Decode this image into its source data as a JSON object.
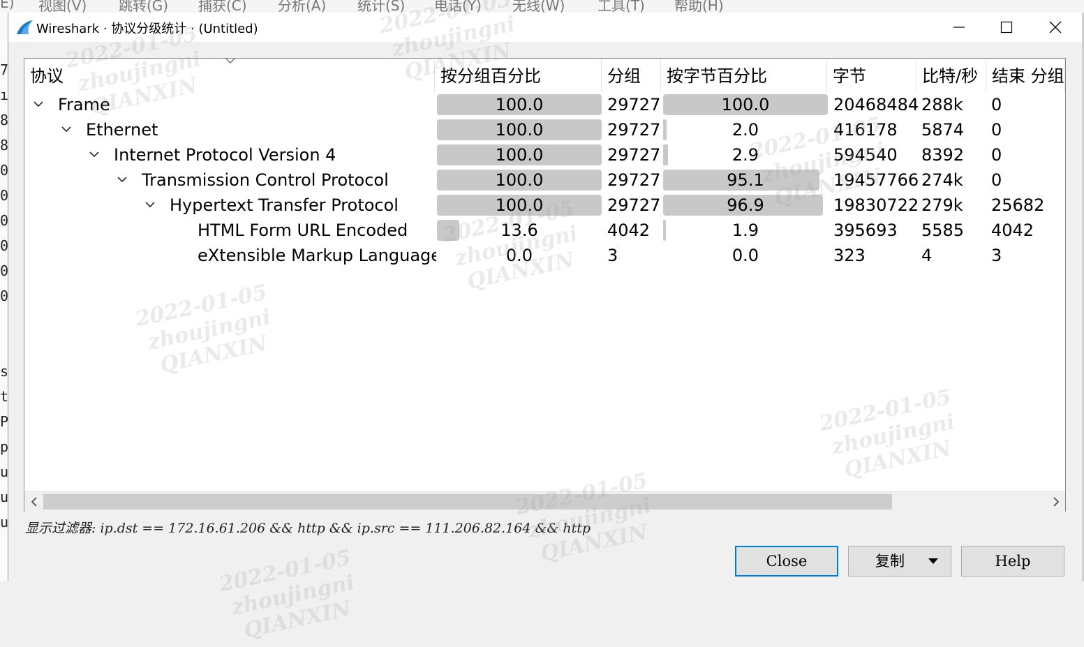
{
  "background_window": {
    "menu": [
      "E)",
      "视图(V)",
      "跳转(G)",
      "捕获(C)",
      "分析(A)",
      "统计(S)",
      "电话(Y)",
      "无线(W)",
      "工具(T)",
      "帮助(H)"
    ],
    "left_fragments": [
      "7",
      "ı",
      "8",
      "8",
      "0",
      "0",
      "0",
      "0",
      "0",
      "0",
      "",
      "",
      "s",
      "t",
      "P",
      "p",
      "u",
      "u",
      "u"
    ]
  },
  "titlebar": {
    "title": "Wireshark · 协议分级统计 · (Untitled)"
  },
  "columns": [
    "协议",
    "按分组百分比",
    "分组",
    "按字节百分比",
    "字节",
    "比特/秒",
    "结束 分组"
  ],
  "rows": [
    {
      "level": 0,
      "expandable": true,
      "name": "Frame",
      "pkt_pct": "100.0",
      "pkt_pct_fill": 1.0,
      "packets": "29727",
      "byte_pct": "100.0",
      "byte_pct_fill": 1.0,
      "bytes": "20468484",
      "bps": "288k",
      "end_packets": "0"
    },
    {
      "level": 1,
      "expandable": true,
      "name": "Ethernet",
      "pkt_pct": "100.0",
      "pkt_pct_fill": 1.0,
      "packets": "29727",
      "byte_pct": "2.0",
      "byte_pct_fill": 0.02,
      "bytes": "416178",
      "bps": "5874",
      "end_packets": "0"
    },
    {
      "level": 2,
      "expandable": true,
      "name": "Internet Protocol Version 4",
      "pkt_pct": "100.0",
      "pkt_pct_fill": 1.0,
      "packets": "29727",
      "byte_pct": "2.9",
      "byte_pct_fill": 0.029,
      "bytes": "594540",
      "bps": "8392",
      "end_packets": "0"
    },
    {
      "level": 3,
      "expandable": true,
      "name": "Transmission Control Protocol",
      "pkt_pct": "100.0",
      "pkt_pct_fill": 1.0,
      "packets": "29727",
      "byte_pct": "95.1",
      "byte_pct_fill": 0.951,
      "bytes": "19457766",
      "bps": "274k",
      "end_packets": "0"
    },
    {
      "level": 4,
      "expandable": true,
      "name": "Hypertext Transfer Protocol",
      "pkt_pct": "100.0",
      "pkt_pct_fill": 1.0,
      "packets": "29727",
      "byte_pct": "96.9",
      "byte_pct_fill": 0.969,
      "bytes": "19830722",
      "bps": "279k",
      "end_packets": "25682"
    },
    {
      "level": 5,
      "expandable": false,
      "name": "HTML Form URL Encoded",
      "pkt_pct": "13.6",
      "pkt_pct_fill": 0.136,
      "packets": "4042",
      "byte_pct": "1.9",
      "byte_pct_fill": 0.019,
      "bytes": "395693",
      "bps": "5585",
      "end_packets": "4042"
    },
    {
      "level": 5,
      "expandable": false,
      "name": "eXtensible Markup Language",
      "pkt_pct": "0.0",
      "pkt_pct_fill": 0.0,
      "packets": "3",
      "byte_pct": "0.0",
      "byte_pct_fill": 0.0,
      "bytes": "323",
      "bps": "4",
      "end_packets": "3"
    }
  ],
  "filter_label": "显示过滤器: ip.dst == 172.16.61.206 && http && ip.src == 111.206.82.164 && http",
  "buttons": {
    "close": "Close",
    "copy": "复制",
    "help": "Help"
  },
  "watermark": {
    "date": "2022-01-05",
    "user": "zhoujingni",
    "org": "QIANXIN"
  },
  "colors": {
    "bar": "#c8c8c8",
    "default_button_border": "#0078d7",
    "panel_bg": "#ffffff",
    "dialog_bg": "#f0f0f0"
  }
}
